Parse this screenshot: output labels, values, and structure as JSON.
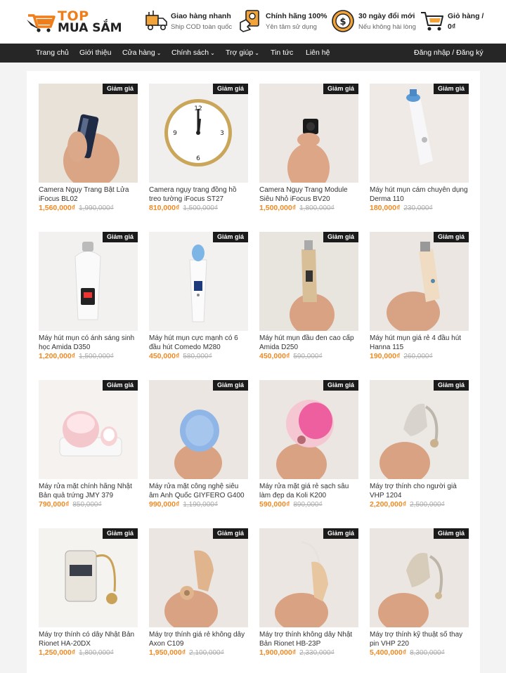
{
  "brand": {
    "top": "TOP",
    "main": "MUA SẮM"
  },
  "features": [
    {
      "title": "Giao hàng nhanh",
      "sub": "Ship COD toàn quốc",
      "icon": "delivery-truck-icon"
    },
    {
      "title": "Chính hãng 100%",
      "sub": "Yên tâm sử dụng",
      "icon": "hand-badge-icon"
    },
    {
      "title": "30 ngày đổi mới",
      "sub": "Nếu không hài lòng",
      "icon": "money-exchange-icon"
    }
  ],
  "cart": {
    "title": "Giỏ hàng /",
    "amount": "0₫"
  },
  "nav": {
    "items": [
      "Trang chủ",
      "Giới thiệu",
      "Cửa hàng",
      "Chính sách",
      "Trợ giúp",
      "Tin tức",
      "Liên hệ"
    ],
    "login": "Đăng nhập / Đăng ký",
    "caret": "⌄"
  },
  "badge": "Giảm giá",
  "products": [
    {
      "name": "Camera Ngụy Trang Bật Lửa iFocus BL02",
      "price": "1,560,000₫",
      "old": "1,990,000₫"
    },
    {
      "name": "Camera ngụy trang đồng hồ treo tường iFocus ST27",
      "price": "810,000₫",
      "old": "1,500,000₫"
    },
    {
      "name": "Camera Ngụy Trang Module Siêu Nhỏ iFocus BV20",
      "price": "1,500,000₫",
      "old": "1,800,000₫"
    },
    {
      "name": "Máy hút mụn cám chuyên dụng Derma 110",
      "price": "180,000₫",
      "old": "230,000₫"
    },
    {
      "name": "Máy hút mụn có ánh sáng sinh học Amida D350",
      "price": "1,200,000₫",
      "old": "1,500,000₫"
    },
    {
      "name": "Máy hút mụn cực mạnh có 6 đầu hút Comedo M280",
      "price": "450,000₫",
      "old": "580,000₫"
    },
    {
      "name": "Máy hút mụn đầu đen cao cấp Amida D250",
      "price": "450,000₫",
      "old": "590,000₫"
    },
    {
      "name": "Máy hút mụn giá rẻ 4 đầu hút Hanna 115",
      "price": "190,000₫",
      "old": "260,000₫"
    },
    {
      "name": "Máy rửa mặt chính hãng Nhật Bản quả trứng JMY 379",
      "price": "790,000₫",
      "old": "850,000₫"
    },
    {
      "name": "Máy rửa mặt công nghệ siêu âm Anh Quốc GIYFERO G400",
      "price": "990,000₫",
      "old": "1,190,000₫"
    },
    {
      "name": "Máy rửa mặt giá rẻ sạch sâu làm đẹp da Koli K200",
      "price": "590,000₫",
      "old": "890,000₫"
    },
    {
      "name": "Máy trợ thính cho người già VHP 1204",
      "price": "2,200,000₫",
      "old": "2,500,000₫"
    },
    {
      "name": "Máy trợ thính có dây Nhật Bản Rionet HA-20DX",
      "price": "1,250,000₫",
      "old": "1,800,000₫"
    },
    {
      "name": "Máy trợ thính giá rẻ không dây Axon C109",
      "price": "1,950,000₫",
      "old": "2,100,000₫"
    },
    {
      "name": "Máy trợ thính không dây Nhật Bản Rionet HB-23P",
      "price": "1,900,000₫",
      "old": "2,330,000₫"
    },
    {
      "name": "Máy trợ thính kỹ thuật số thay pin VHP 220",
      "price": "5,400,000₫",
      "old": "8,300,000₫"
    }
  ],
  "colors": {
    "accent": "#ee8a24",
    "nav_bg": "#262626",
    "badge_bg": "#1a1a1a"
  }
}
